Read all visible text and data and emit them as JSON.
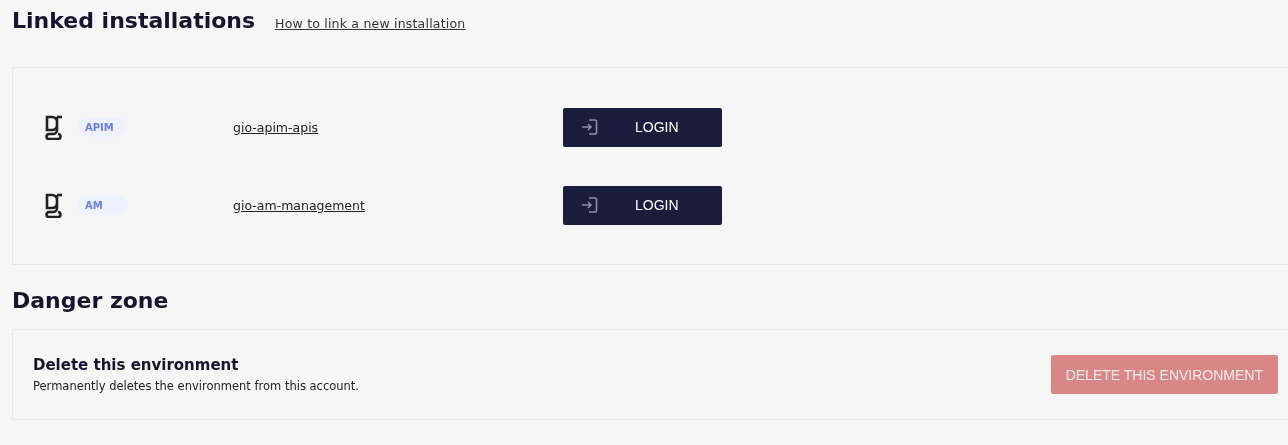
{
  "linked_installations": {
    "title": "Linked installations",
    "help_link": "How to link a new installation",
    "installations": [
      {
        "product": "APIM",
        "name": "gio-apim-apis",
        "button": "LOGIN"
      },
      {
        "product": "AM",
        "name": "gio-am-management",
        "button": "LOGIN"
      }
    ]
  },
  "danger_zone": {
    "title": "Danger zone",
    "item_title": "Delete this environment",
    "item_description": "Permanently deletes the environment from this account.",
    "button": {
      "label": "DELETE THIS ENVIRONMENT",
      "disabled": true
    }
  }
}
